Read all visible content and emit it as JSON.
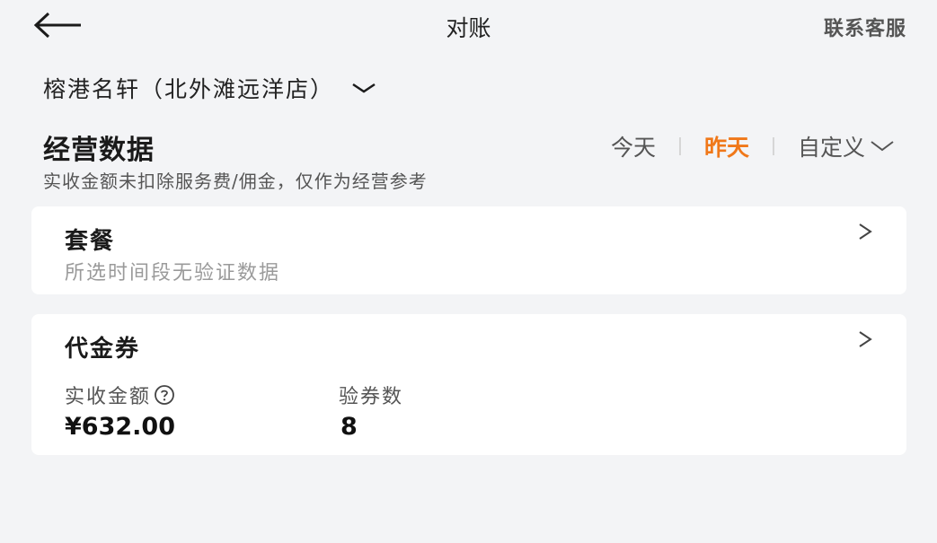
{
  "header": {
    "title": "对账",
    "service_label": "联系客服"
  },
  "store": {
    "name": "榕港名轩（北外滩远洋店）"
  },
  "section": {
    "title": "经营数据",
    "hint": "实收金额未扣除服务费/佣金，仅作为经营参考"
  },
  "date_tabs": {
    "items": [
      {
        "label": "今天",
        "active": false
      },
      {
        "label": "昨天",
        "active": true
      },
      {
        "label": "自定义",
        "active": false
      }
    ]
  },
  "cards": {
    "package": {
      "title": "套餐",
      "empty_text": "所选时间段无验证数据"
    },
    "voucher": {
      "title": "代金券",
      "metrics": [
        {
          "label": "实收金额",
          "value": "¥632.00"
        },
        {
          "label": "验券数",
          "value": "8"
        }
      ]
    }
  },
  "colors": {
    "accent": "#f07819",
    "background": "#f3f4f6",
    "card": "#ffffff"
  },
  "icons": [
    "back-arrow-icon",
    "chevron-down-icon",
    "chevron-right-icon",
    "question-circle-icon"
  ]
}
